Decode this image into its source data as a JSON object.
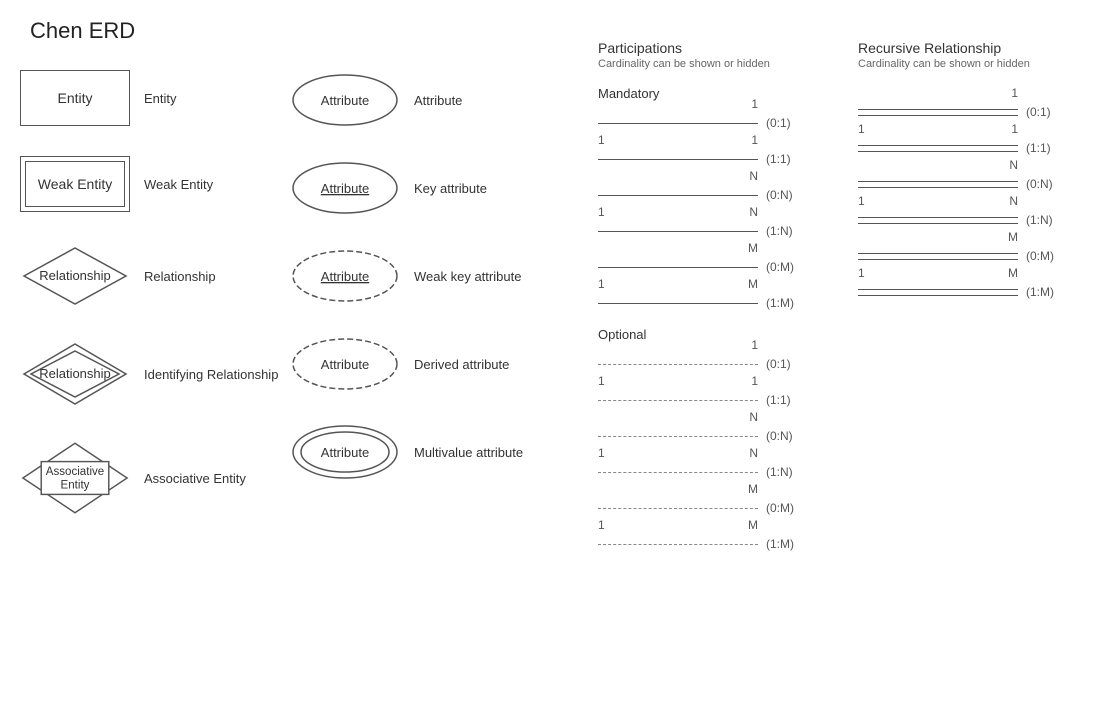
{
  "title": "Chen ERD",
  "shapes": {
    "entity": {
      "label": "Entity",
      "text": "Entity"
    },
    "weak_entity": {
      "label": "Weak Entity",
      "text": "Weak Entity"
    },
    "relationship": {
      "label": "Relationship",
      "text": "Relationship"
    },
    "identifying_relationship": {
      "label": "Identifying Relationship",
      "text": "Relationship"
    },
    "associative_entity": {
      "label": "Associative Entity",
      "text": "Associative\nEntity"
    }
  },
  "attributes": {
    "attribute": {
      "label": "Attribute",
      "text": "Attribute"
    },
    "key_attribute": {
      "label": "Key attribute",
      "text": "Attribute"
    },
    "weak_key_attribute": {
      "label": "Weak key attribute",
      "text": "Attribute"
    },
    "derived_attribute": {
      "label": "Derived attribute",
      "text": "Attribute"
    },
    "multivalue_attribute": {
      "label": "Multivalue attribute",
      "text": "Attribute"
    }
  },
  "participations": {
    "title": "Participations",
    "subtitle": "Cardinality can be shown or hidden",
    "mandatory_label": "Mandatory",
    "optional_label": "Optional",
    "mandatory_rows": [
      {
        "left": "",
        "right": "1",
        "card": "(0:1)"
      },
      {
        "left": "1",
        "right": "1",
        "card": "(1:1)"
      },
      {
        "left": "",
        "right": "N",
        "card": "(0:N)"
      },
      {
        "left": "1",
        "right": "N",
        "card": "(1:N)"
      },
      {
        "left": "",
        "right": "M",
        "card": "(0:M)"
      },
      {
        "left": "1",
        "right": "M",
        "card": "(1:M)"
      }
    ],
    "optional_rows": [
      {
        "left": "",
        "right": "1",
        "card": "(0:1)"
      },
      {
        "left": "1",
        "right": "1",
        "card": "(1:1)"
      },
      {
        "left": "",
        "right": "N",
        "card": "(0:N)"
      },
      {
        "left": "1",
        "right": "N",
        "card": "(1:N)"
      },
      {
        "left": "",
        "right": "M",
        "card": "(0:M)"
      },
      {
        "left": "1",
        "right": "M",
        "card": "(1:M)"
      }
    ]
  },
  "recursive": {
    "title": "Recursive Relationship",
    "subtitle": "Cardinality can be shown or hidden",
    "rows": [
      {
        "left": "",
        "right": "1",
        "card": "(0:1)"
      },
      {
        "left": "1",
        "right": "1",
        "card": "(1:1)"
      },
      {
        "left": "",
        "right": "N",
        "card": "(0:N)"
      },
      {
        "left": "1",
        "right": "N",
        "card": "(1:N)"
      },
      {
        "left": "",
        "right": "M",
        "card": "(0:M)"
      },
      {
        "left": "1",
        "right": "M",
        "card": "(1:M)"
      }
    ]
  }
}
